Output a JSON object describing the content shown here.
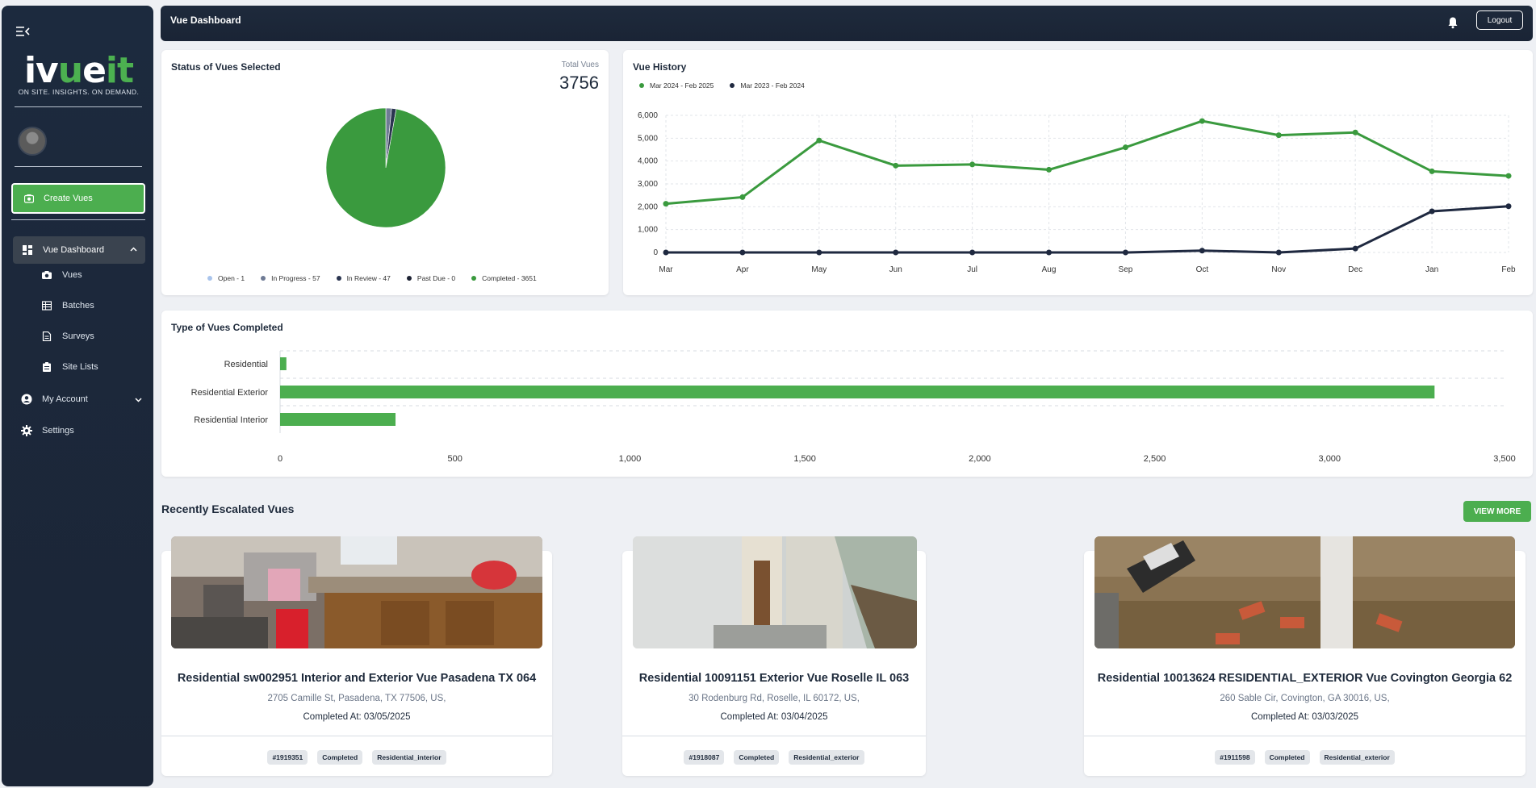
{
  "sidebar": {
    "logo_text_white_1": "iv",
    "logo_text_green_1": "u",
    "logo_text_white_2": "e",
    "logo_text_green_2": "it",
    "logo_tagline": "ON SITE. INSIGHTS. ON DEMAND.",
    "create_button": "Create Vues",
    "dashboard_label": "Vue Dashboard",
    "sub_items": [
      "Vues",
      "Batches",
      "Surveys",
      "Site Lists"
    ],
    "my_account": "My Account",
    "settings": "Settings"
  },
  "header": {
    "title": "Vue Dashboard",
    "logout": "Logout"
  },
  "status_card": {
    "title": "Status of Vues Selected",
    "total_label": "Total Vues",
    "total_value": "3756",
    "legend": [
      {
        "label": "Open - 1",
        "color": "#a9c4ec"
      },
      {
        "label": "In Progress - 57",
        "color": "#6f7b95"
      },
      {
        "label": "In Review - 47",
        "color": "#2b3550"
      },
      {
        "label": "Past Due - 0",
        "color": "#1d2233"
      },
      {
        "label": "Completed - 3651",
        "color": "#3a9a3e"
      }
    ]
  },
  "history_card": {
    "title": "Vue History",
    "legend": [
      {
        "label": "Mar 2024 - Feb 2025",
        "color": "#3a9a3e"
      },
      {
        "label": "Mar 2023 - Feb 2024",
        "color": "#1f2940"
      }
    ]
  },
  "type_card": {
    "title": "Type of Vues Completed"
  },
  "escalated": {
    "title": "Recently Escalated Vues",
    "view_more": "VIEW MORE",
    "cards": [
      {
        "title": "Residential sw002951 Interior and Exterior Vue Pasadena TX 064",
        "address": "2705 Camille St, Pasadena, TX 77506, US,",
        "completed": "Completed At: 03/05/2025",
        "chips": [
          "#1919351",
          "Completed",
          "Residential_interior"
        ]
      },
      {
        "title": "Residential 10091151 Exterior Vue Roselle IL 063",
        "address": "30 Rodenburg Rd, Roselle, IL 60172, US,",
        "completed": "Completed At: 03/04/2025",
        "chips": [
          "#1918087",
          "Completed",
          "Residential_exterior"
        ]
      },
      {
        "title": "Residential 10013624 RESIDENTIAL_EXTERIOR Vue Covington Georgia 62",
        "address": "260 Sable Cir, Covington, GA 30016, US,",
        "completed": "Completed At: 03/03/2025",
        "chips": [
          "#1911598",
          "Completed",
          "Residential_exterior"
        ]
      }
    ]
  },
  "chart_data": [
    {
      "type": "pie",
      "title": "Status of Vues Selected",
      "categories": [
        "Open",
        "In Progress",
        "In Review",
        "Past Due",
        "Completed"
      ],
      "values": [
        1,
        57,
        47,
        0,
        3651
      ],
      "colors": [
        "#a9c4ec",
        "#6f7b95",
        "#2b3550",
        "#1d2233",
        "#3a9a3e"
      ]
    },
    {
      "type": "line",
      "title": "Vue History",
      "categories": [
        "Mar",
        "Apr",
        "May",
        "Jun",
        "Jul",
        "Aug",
        "Sep",
        "Oct",
        "Nov",
        "Dec",
        "Jan",
        "Feb"
      ],
      "ylim": [
        0,
        6000
      ],
      "yticks": [
        0,
        1000,
        2000,
        3000,
        4000,
        5000,
        6000
      ],
      "ytick_labels": [
        "0",
        "1,000",
        "2,000",
        "3,000",
        "4,000",
        "5,000",
        "6,000"
      ],
      "grid": true,
      "legend_position": "top-left",
      "series": [
        {
          "name": "Mar 2024 - Feb 2025",
          "color": "#3a9a3e",
          "values": [
            2130,
            2420,
            4900,
            3800,
            3850,
            3620,
            4600,
            5750,
            5130,
            5250,
            3550,
            3350
          ]
        },
        {
          "name": "Mar 2023 - Feb 2024",
          "color": "#1f2940",
          "values": [
            0,
            0,
            0,
            0,
            0,
            0,
            0,
            80,
            0,
            170,
            1800,
            2020
          ]
        }
      ]
    },
    {
      "type": "bar",
      "orientation": "horizontal",
      "title": "Type of Vues Completed",
      "categories": [
        "Residential",
        "Residential Exterior",
        "Residential Interior"
      ],
      "values": [
        18,
        3300,
        330
      ],
      "color": "#4cae4f",
      "xlim": [
        0,
        3500
      ],
      "xticks": [
        0,
        500,
        1000,
        1500,
        2000,
        2500,
        3000,
        3500
      ],
      "xtick_labels": [
        "0",
        "500",
        "1,000",
        "1,500",
        "2,000",
        "2,500",
        "3,000",
        "3,500"
      ]
    }
  ]
}
